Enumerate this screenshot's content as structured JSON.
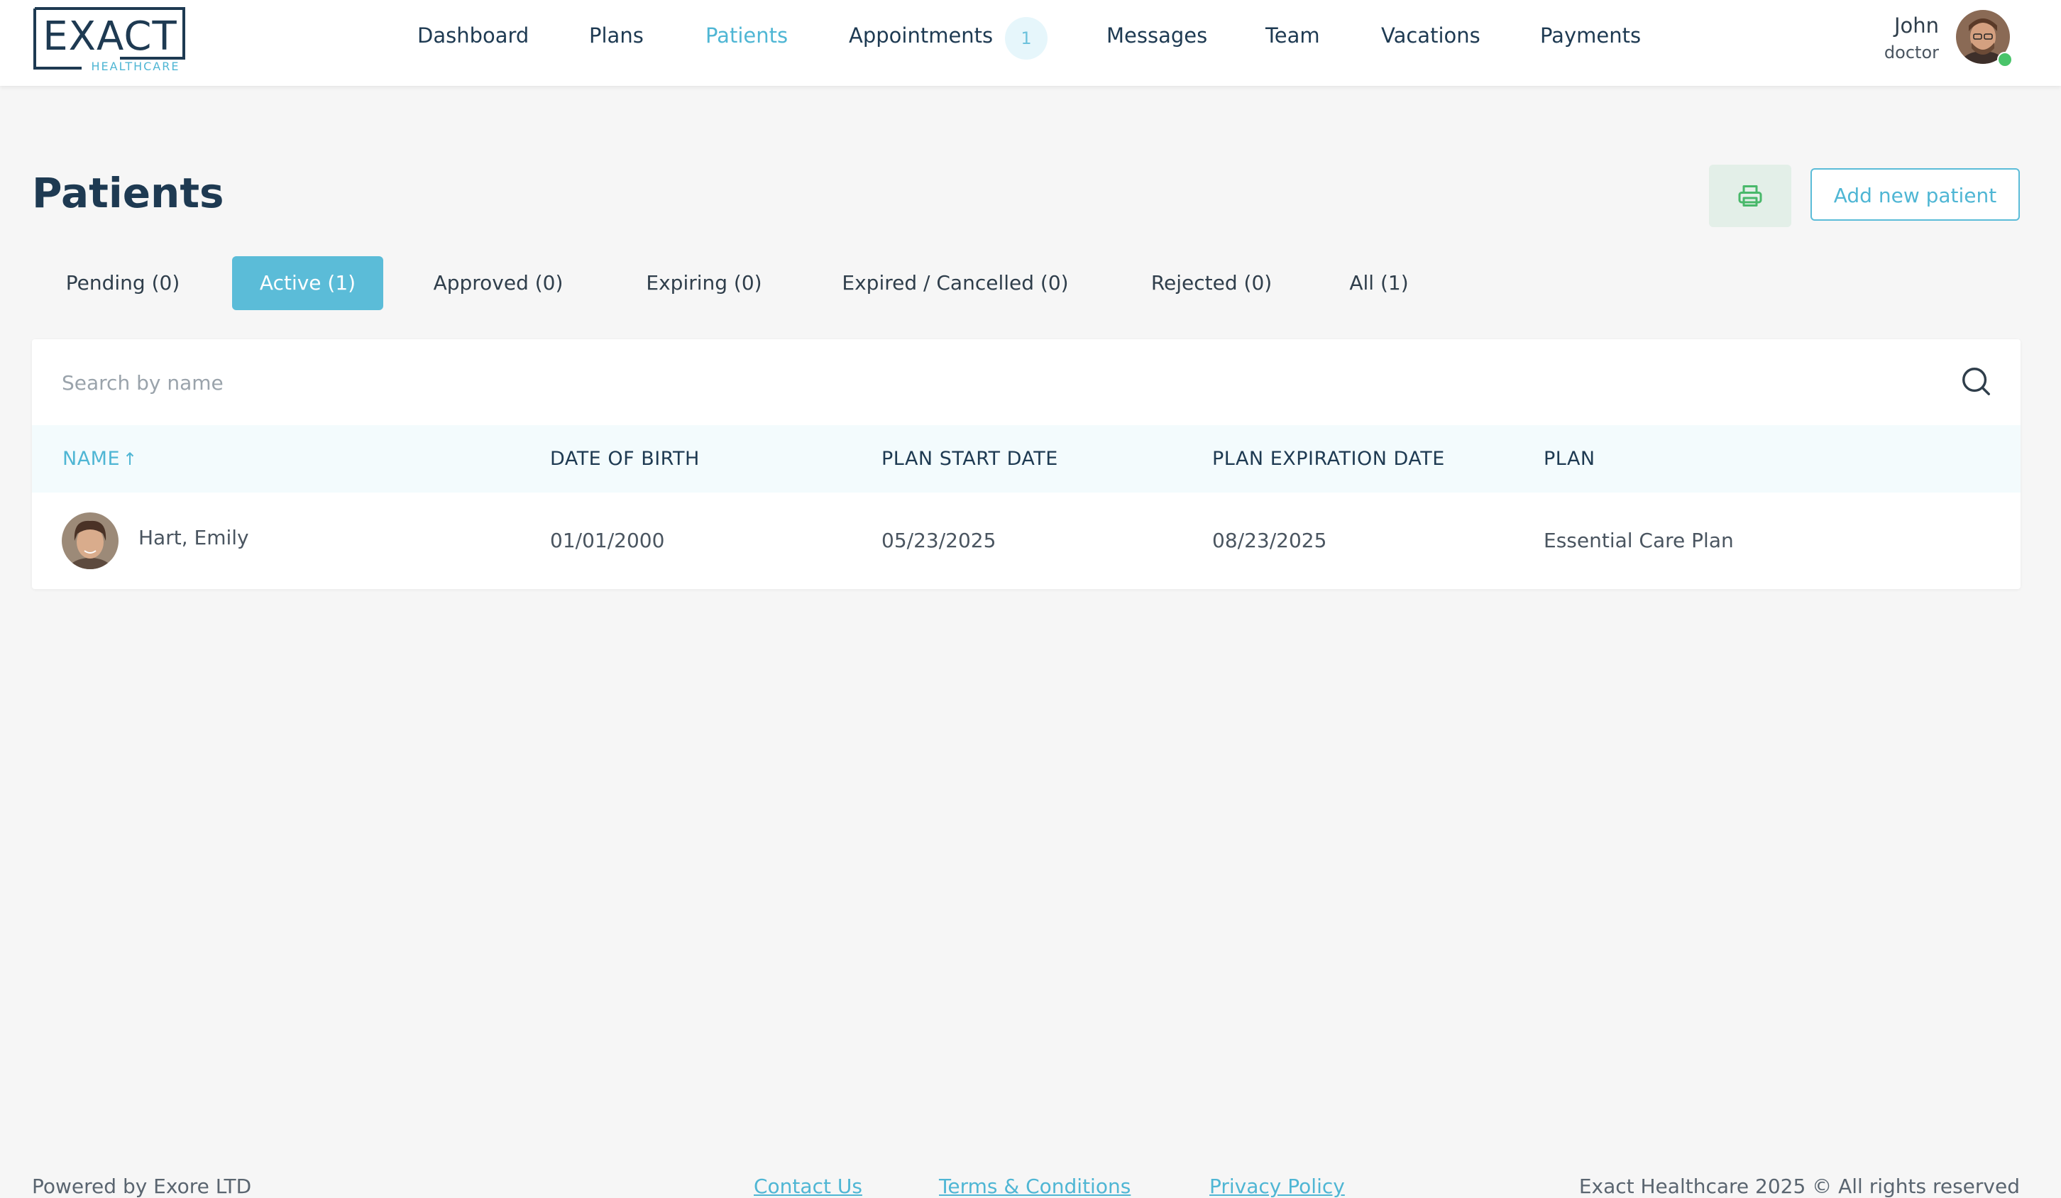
{
  "app": {
    "logo_text": "EXACT",
    "logo_subtext": "HEALTHCARE"
  },
  "nav": {
    "items": [
      {
        "label": "Dashboard"
      },
      {
        "label": "Plans"
      },
      {
        "label": "Patients",
        "active": true
      },
      {
        "label": "Appointments",
        "badge": "1"
      },
      {
        "label": "Messages"
      },
      {
        "label": "Team"
      },
      {
        "label": "Vacations"
      },
      {
        "label": "Payments"
      }
    ]
  },
  "user": {
    "name": "John",
    "role": "doctor",
    "status": "online"
  },
  "page": {
    "title": "Patients",
    "add_button_label": "Add new patient",
    "print_icon": "printer-icon"
  },
  "tabs": [
    {
      "label": "Pending (0)"
    },
    {
      "label": "Active (1)",
      "active": true
    },
    {
      "label": "Approved (0)"
    },
    {
      "label": "Expiring (0)"
    },
    {
      "label": "Expired / Cancelled (0)"
    },
    {
      "label": "Rejected (0)"
    },
    {
      "label": "All (1)"
    }
  ],
  "search": {
    "placeholder": "Search by name",
    "value": ""
  },
  "table": {
    "columns": [
      "NAME",
      "DATE OF BIRTH",
      "PLAN START DATE",
      "PLAN EXPIRATION DATE",
      "PLAN"
    ],
    "sort_column": "NAME",
    "sort_direction": "ascending",
    "rows": [
      {
        "name": "Hart, Emily",
        "date_of_birth": "01/01/2000",
        "plan_start_date": "05/23/2025",
        "plan_expiration_date": "08/23/2025",
        "plan": "Essential Care Plan"
      }
    ]
  },
  "footer": {
    "powered_by": "Powered by Exore LTD",
    "links": [
      "Contact Us",
      "Terms & Conditions",
      "Privacy Policy"
    ],
    "copyright": "Exact Healthcare 2025 © All rights reserved"
  },
  "colors": {
    "accent": "#4fb6d4",
    "tab_active_bg": "#5bbcd8",
    "navy": "#1e3a52",
    "background": "#f6f6f6",
    "online": "#49c46a",
    "print_button_bg": "#e3efe8",
    "print_icon": "#48b86a"
  }
}
